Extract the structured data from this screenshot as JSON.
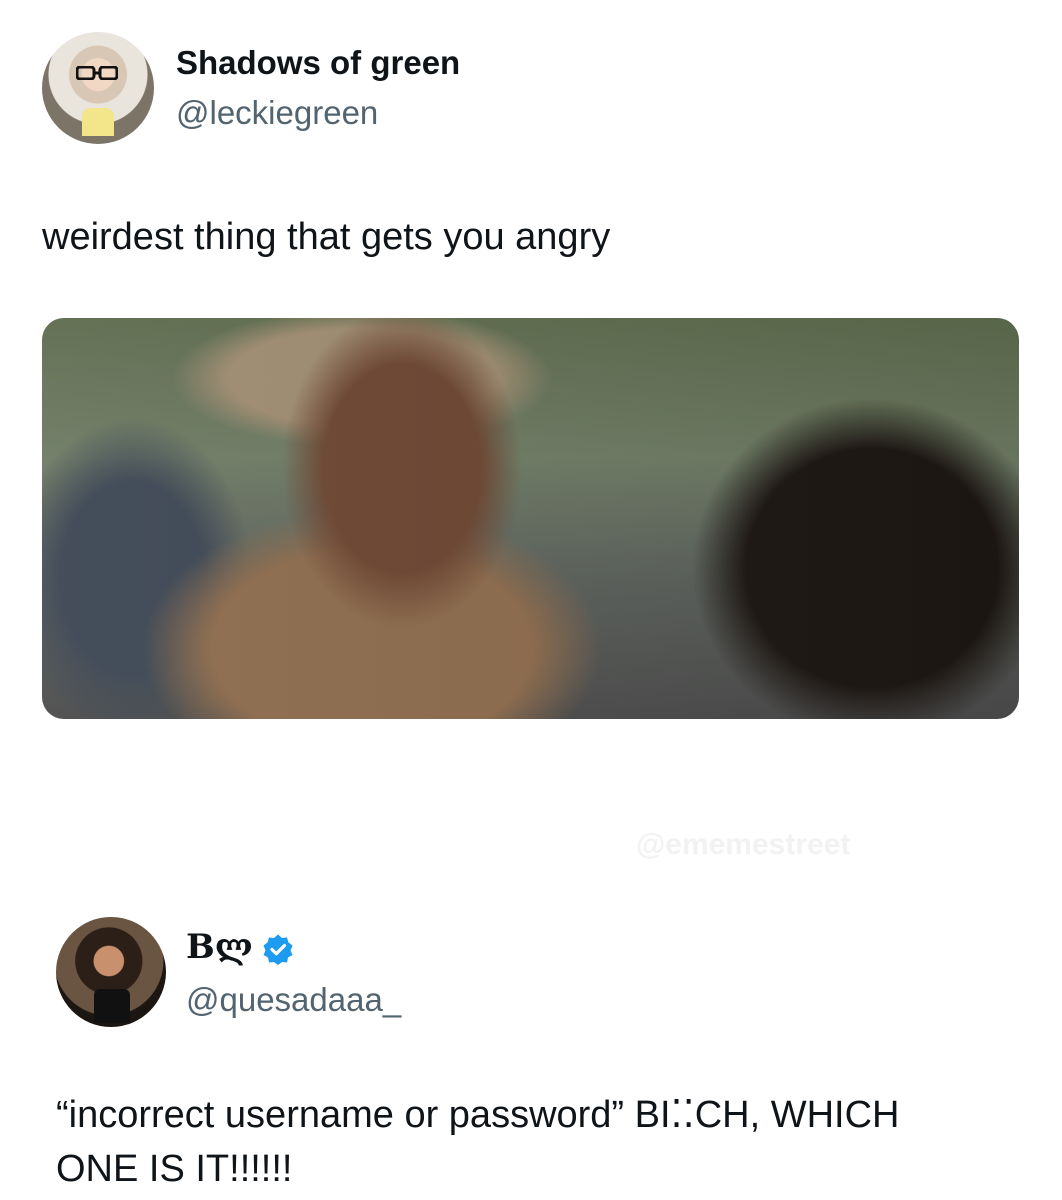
{
  "tweet1": {
    "display_name": "Shadows of green",
    "handle": "@leckiegreen",
    "text": "weirdest thing that gets you angry",
    "media_alt": "motion-blurred scene of a man in a tan hat and coat being punched"
  },
  "tweet2": {
    "display_name": "Bლ",
    "handle": "@quesadaaa_",
    "verified": true,
    "text_line1": "“incorrect username or password” BI⁚⁚CH, WHICH",
    "text_line2": "ONE IS IT!!!!!!"
  },
  "watermark": {
    "text": "@ememestreet"
  },
  "colors": {
    "text": "#0f1419",
    "secondary": "#536471",
    "verified": "#1d9bf0"
  }
}
